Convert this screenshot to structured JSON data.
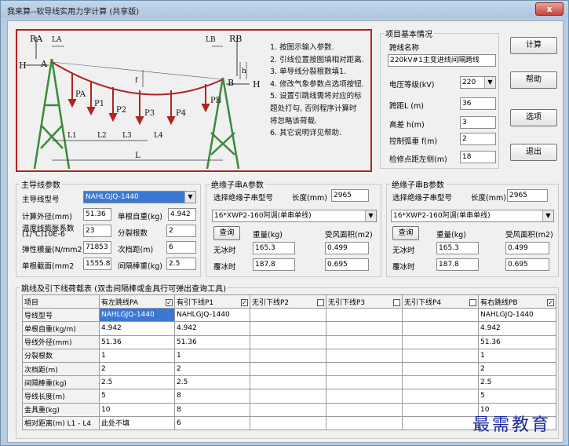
{
  "window": {
    "title": "我来算--软导线实用力学计算 (共享版)",
    "close_glyph": "x"
  },
  "diagram": {
    "labels": {
      "RA": "RA",
      "LA": "LA",
      "LB": "LB",
      "RB": "RB",
      "H_left": "H",
      "A": "A",
      "H_right": "H",
      "B": "B",
      "h": "h",
      "f": "f",
      "PA": "PA",
      "P1": "P1",
      "P2": "P2",
      "P3": "P3",
      "P4": "P4",
      "PB": "PB",
      "L1": "L1",
      "L2": "L2",
      "L3": "L3",
      "L4": "L4",
      "L": "L"
    },
    "notes": [
      "1. 按图示输入参数.",
      "2. 引线位置按图填相对距离.",
      "3. 单导线分裂根数填1.",
      "4. 修改气象参数点选项按钮.",
      "5. 设置引跳线需将对应的标",
      "   题处打勾, 否则程序计算时",
      "   将忽略该荷载.",
      "6. 其它说明详见帮助."
    ]
  },
  "project": {
    "legend": "项目基本情况",
    "span_name_label": "跨线名称",
    "span_name_value": "220kV#1主变进线间隔跨线",
    "voltage_label": "电压等级(kV)",
    "voltage_value": "220",
    "span_label": "跨距L (m)",
    "span_value": "36",
    "height_diff_label": "高差 h(m)",
    "height_diff_value": "3",
    "sag_label": "控制弧垂 f(m)",
    "sag_value": "2",
    "repair_label": "检修点距左侧(m)",
    "repair_value": "18"
  },
  "buttons": {
    "calc": "计算",
    "help": "帮助",
    "options": "选项",
    "exit": "退出"
  },
  "conductor": {
    "legend": "主导线参数",
    "model_label": "主导线型号",
    "model_value": "NAHLGJQ-1440",
    "diameter_label": "计算外径(mm)",
    "diameter_value": "51.36",
    "unit_weight_label": "单根自重(kg)",
    "unit_weight_value": "4.942",
    "expansion_label_1": "温度线膨胀系数",
    "expansion_label_2": "(1/℃)10E-6",
    "expansion_value": "23",
    "split_label": "分裂根数",
    "split_value": "2",
    "modulus_label": "弹性模量(N/mm2",
    "modulus_value": "71853",
    "spacer_dist_label": "次档距(m)",
    "spacer_dist_value": "6",
    "section_label": "单根截面(mm2",
    "section_value": "1555.8",
    "spacer_weight_label": "间隔棒重(kg)",
    "spacer_weight_value": "2.5"
  },
  "insulator_a": {
    "legend": "绝缘子串A参数",
    "select_label": "选择绝缘子串型号",
    "length_label": "长度(mm)",
    "length_value": "2965",
    "model_value": "16*XWP2-160阿调(单串单线)",
    "query_button": "查询",
    "weight_header": "重量(kg)",
    "wind_area_header": "受风面积(m2)",
    "no_ice_label": "无冰时",
    "no_ice_weight": "165.3",
    "no_ice_area": "0.499",
    "ice_label": "覆冰时",
    "ice_weight": "187.8",
    "ice_area": "0.695"
  },
  "insulator_b": {
    "legend": "绝缘子串B参数",
    "select_label": "选择绝缘子串型号",
    "length_label": "长度(mm)",
    "length_value": "2965",
    "model_value": "16*XWP2-160阿调(单串单线)",
    "query_button": "查询",
    "weight_header": "重量(kg)",
    "wind_area_header": "受风面积(m2)",
    "no_ice_label": "无冰时",
    "no_ice_weight": "165.3",
    "no_ice_area": "0.499",
    "ice_label": "覆冰时",
    "ice_weight": "187.8",
    "ice_area": "0.695"
  },
  "load_table": {
    "legend": "跳线及引下线荷载表 (双击间隔棒或金具行可弹出查询工具)",
    "columns": [
      {
        "label": "项目",
        "checkbox": null
      },
      {
        "label": "有左跳线PA",
        "checkbox": "✓"
      },
      {
        "label": "有引下线P1",
        "checkbox": "✓"
      },
      {
        "label": "无引下线P2",
        "checkbox": ""
      },
      {
        "label": "无引下线P3",
        "checkbox": ""
      },
      {
        "label": "无引下线P4",
        "checkbox": ""
      },
      {
        "label": "有右跳线PB",
        "checkbox": "✓"
      }
    ],
    "rows": [
      [
        "导线型号",
        "NAHLGJQ-1440",
        "NAHLGJQ-1440",
        "",
        "",
        "",
        "NAHLGJQ-1440"
      ],
      [
        "单根自重(kg/m)",
        "4.942",
        "4.942",
        "",
        "",
        "",
        "4.942"
      ],
      [
        "导线外径(mm)",
        "51.36",
        "51.36",
        "",
        "",
        "",
        "51.36"
      ],
      [
        "分裂根数",
        "1",
        "1",
        "",
        "",
        "",
        "1"
      ],
      [
        "次档距(m)",
        "2",
        "2",
        "",
        "",
        "",
        "2"
      ],
      [
        "间隔棒重(kg)",
        "2.5",
        "2.5",
        "",
        "",
        "",
        "2.5"
      ],
      [
        "导线长度(m)",
        "5",
        "8",
        "",
        "",
        "",
        "5"
      ],
      [
        "金具重(kg)",
        "10",
        "8",
        "",
        "",
        "",
        "10"
      ],
      [
        "相对距离(m) L1 - L4",
        "此处不填",
        "6",
        "",
        "",
        "",
        ""
      ]
    ]
  },
  "watermark": "最需教育"
}
